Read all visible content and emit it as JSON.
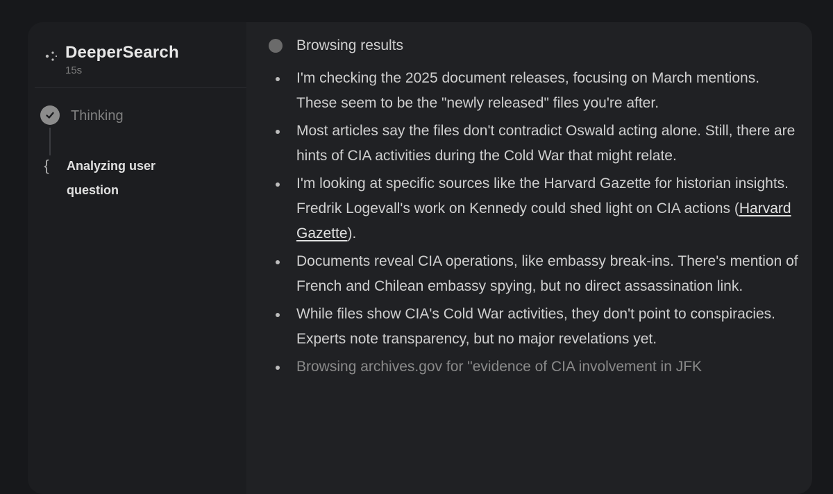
{
  "sidebar": {
    "title": "DeeperSearch",
    "duration": "15s",
    "steps": [
      {
        "label": "Thinking",
        "status": "done"
      },
      {
        "label": "Analyzing user question",
        "status": "active"
      }
    ]
  },
  "content": {
    "section_title": "Browsing results",
    "bullets": [
      {
        "text": "I'm checking the 2025 document releases, focusing on March mentions. These seem to be the \"newly released\" files you're after."
      },
      {
        "text": "Most articles say the files don't contradict Oswald acting alone. Still, there are hints of CIA activities during the Cold War that might relate."
      },
      {
        "text_before": "I'm looking at specific sources like the Harvard Gazette for historian insights. Fredrik Logevall's work on Kennedy could shed light on CIA actions (",
        "link": "Harvard Gazette",
        "text_after": ")."
      },
      {
        "text": "Documents reveal CIA operations, like embassy break-ins. There's mention of French and Chilean embassy spying, but no direct assassination link."
      },
      {
        "text": "While files show CIA's Cold War activities, they don't point to conspiracies. Experts note transparency, but no major revelations yet."
      },
      {
        "text": "Browsing archives.gov for \"evidence of CIA involvement in JFK"
      }
    ]
  },
  "colors": {
    "background": "#17181b",
    "panel": "#1e1f22",
    "sidebar": "#1c1d20",
    "content": "#202124",
    "text": "#cfcfcf"
  },
  "icons": {
    "brand": "sparkle-icon",
    "thinking_step": "check-circle-icon",
    "analyzing_step": "bracket-icon",
    "browsing": "globe-icon"
  }
}
